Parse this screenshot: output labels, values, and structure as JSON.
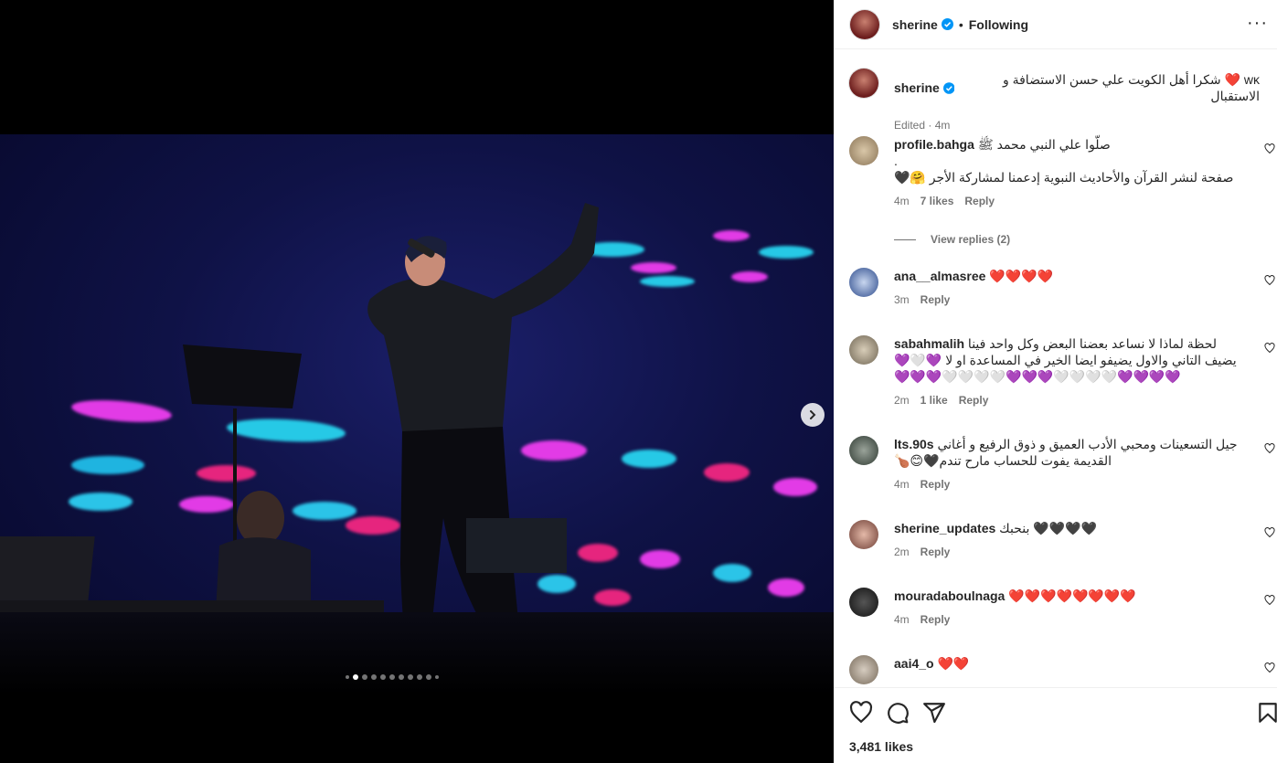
{
  "post": {
    "author": "sherine",
    "follow_status": "Following",
    "separator": "•",
    "more_label": "···",
    "caption": "wĸ ❤️ شكرا أهل الكويت علي حسن الاستضافة و الاستقبال",
    "caption_meta": "Edited · 4m",
    "likes": "3,481 likes"
  },
  "comments": [
    {
      "user": "profile.bahga",
      "text": "صلّوا علي النبي محمد ﷺ\n.\n🖤🤗 صفحة لنشر القرآن والأحاديث النبوية إدعمنا لمشاركة الأجر",
      "time": "4m",
      "likes": "7 likes",
      "reply": "Reply",
      "view_replies": "View replies (2)"
    },
    {
      "user": "ana__almasree",
      "text": "❤️❤️❤️❤️",
      "time": "3m",
      "likes": "",
      "reply": "Reply"
    },
    {
      "user": "sabahmalih",
      "text": "لحظة لماذا لا نساعد بعضنا البعض وكل واحد فينا\n💜🤍💜 يضيف التاني والاول يضيفو ايضا الخير في المساعدة او لا\n💜💜💜🤍🤍🤍🤍💜💜💜🤍🤍🤍🤍💜💜💜💜",
      "time": "2m",
      "likes": "1 like",
      "reply": "Reply"
    },
    {
      "user": "lts.90s",
      "text": "جيل التسعينات ومحبي الأدب العميق و ذوق الرفيع و أغاني\n🍗😊🖤القديمة يفوت للحساب مارح تندم",
      "time": "4m",
      "likes": "",
      "reply": "Reply"
    },
    {
      "user": "sherine_updates",
      "text": "بنحبك 🖤🖤🖤🖤",
      "time": "2m",
      "likes": "",
      "reply": "Reply"
    },
    {
      "user": "mouradaboulnaga",
      "text": "❤️❤️❤️❤️❤️❤️❤️❤️",
      "time": "4m",
      "likes": "",
      "reply": "Reply"
    },
    {
      "user": "aai4_o",
      "text": "❤️❤️",
      "time": "",
      "likes": "",
      "reply": ""
    }
  ],
  "icons": {
    "like": "heart-icon",
    "comment": "comment-icon",
    "share": "share-icon",
    "save": "bookmark-icon",
    "next": "chevron-right-icon",
    "verified": "verified-badge-icon"
  },
  "carousel": {
    "total": 10,
    "active": 2
  },
  "colors": {
    "brand_blue": "#0095f6",
    "text": "#262626",
    "muted": "#737373",
    "border": "#efefef"
  }
}
